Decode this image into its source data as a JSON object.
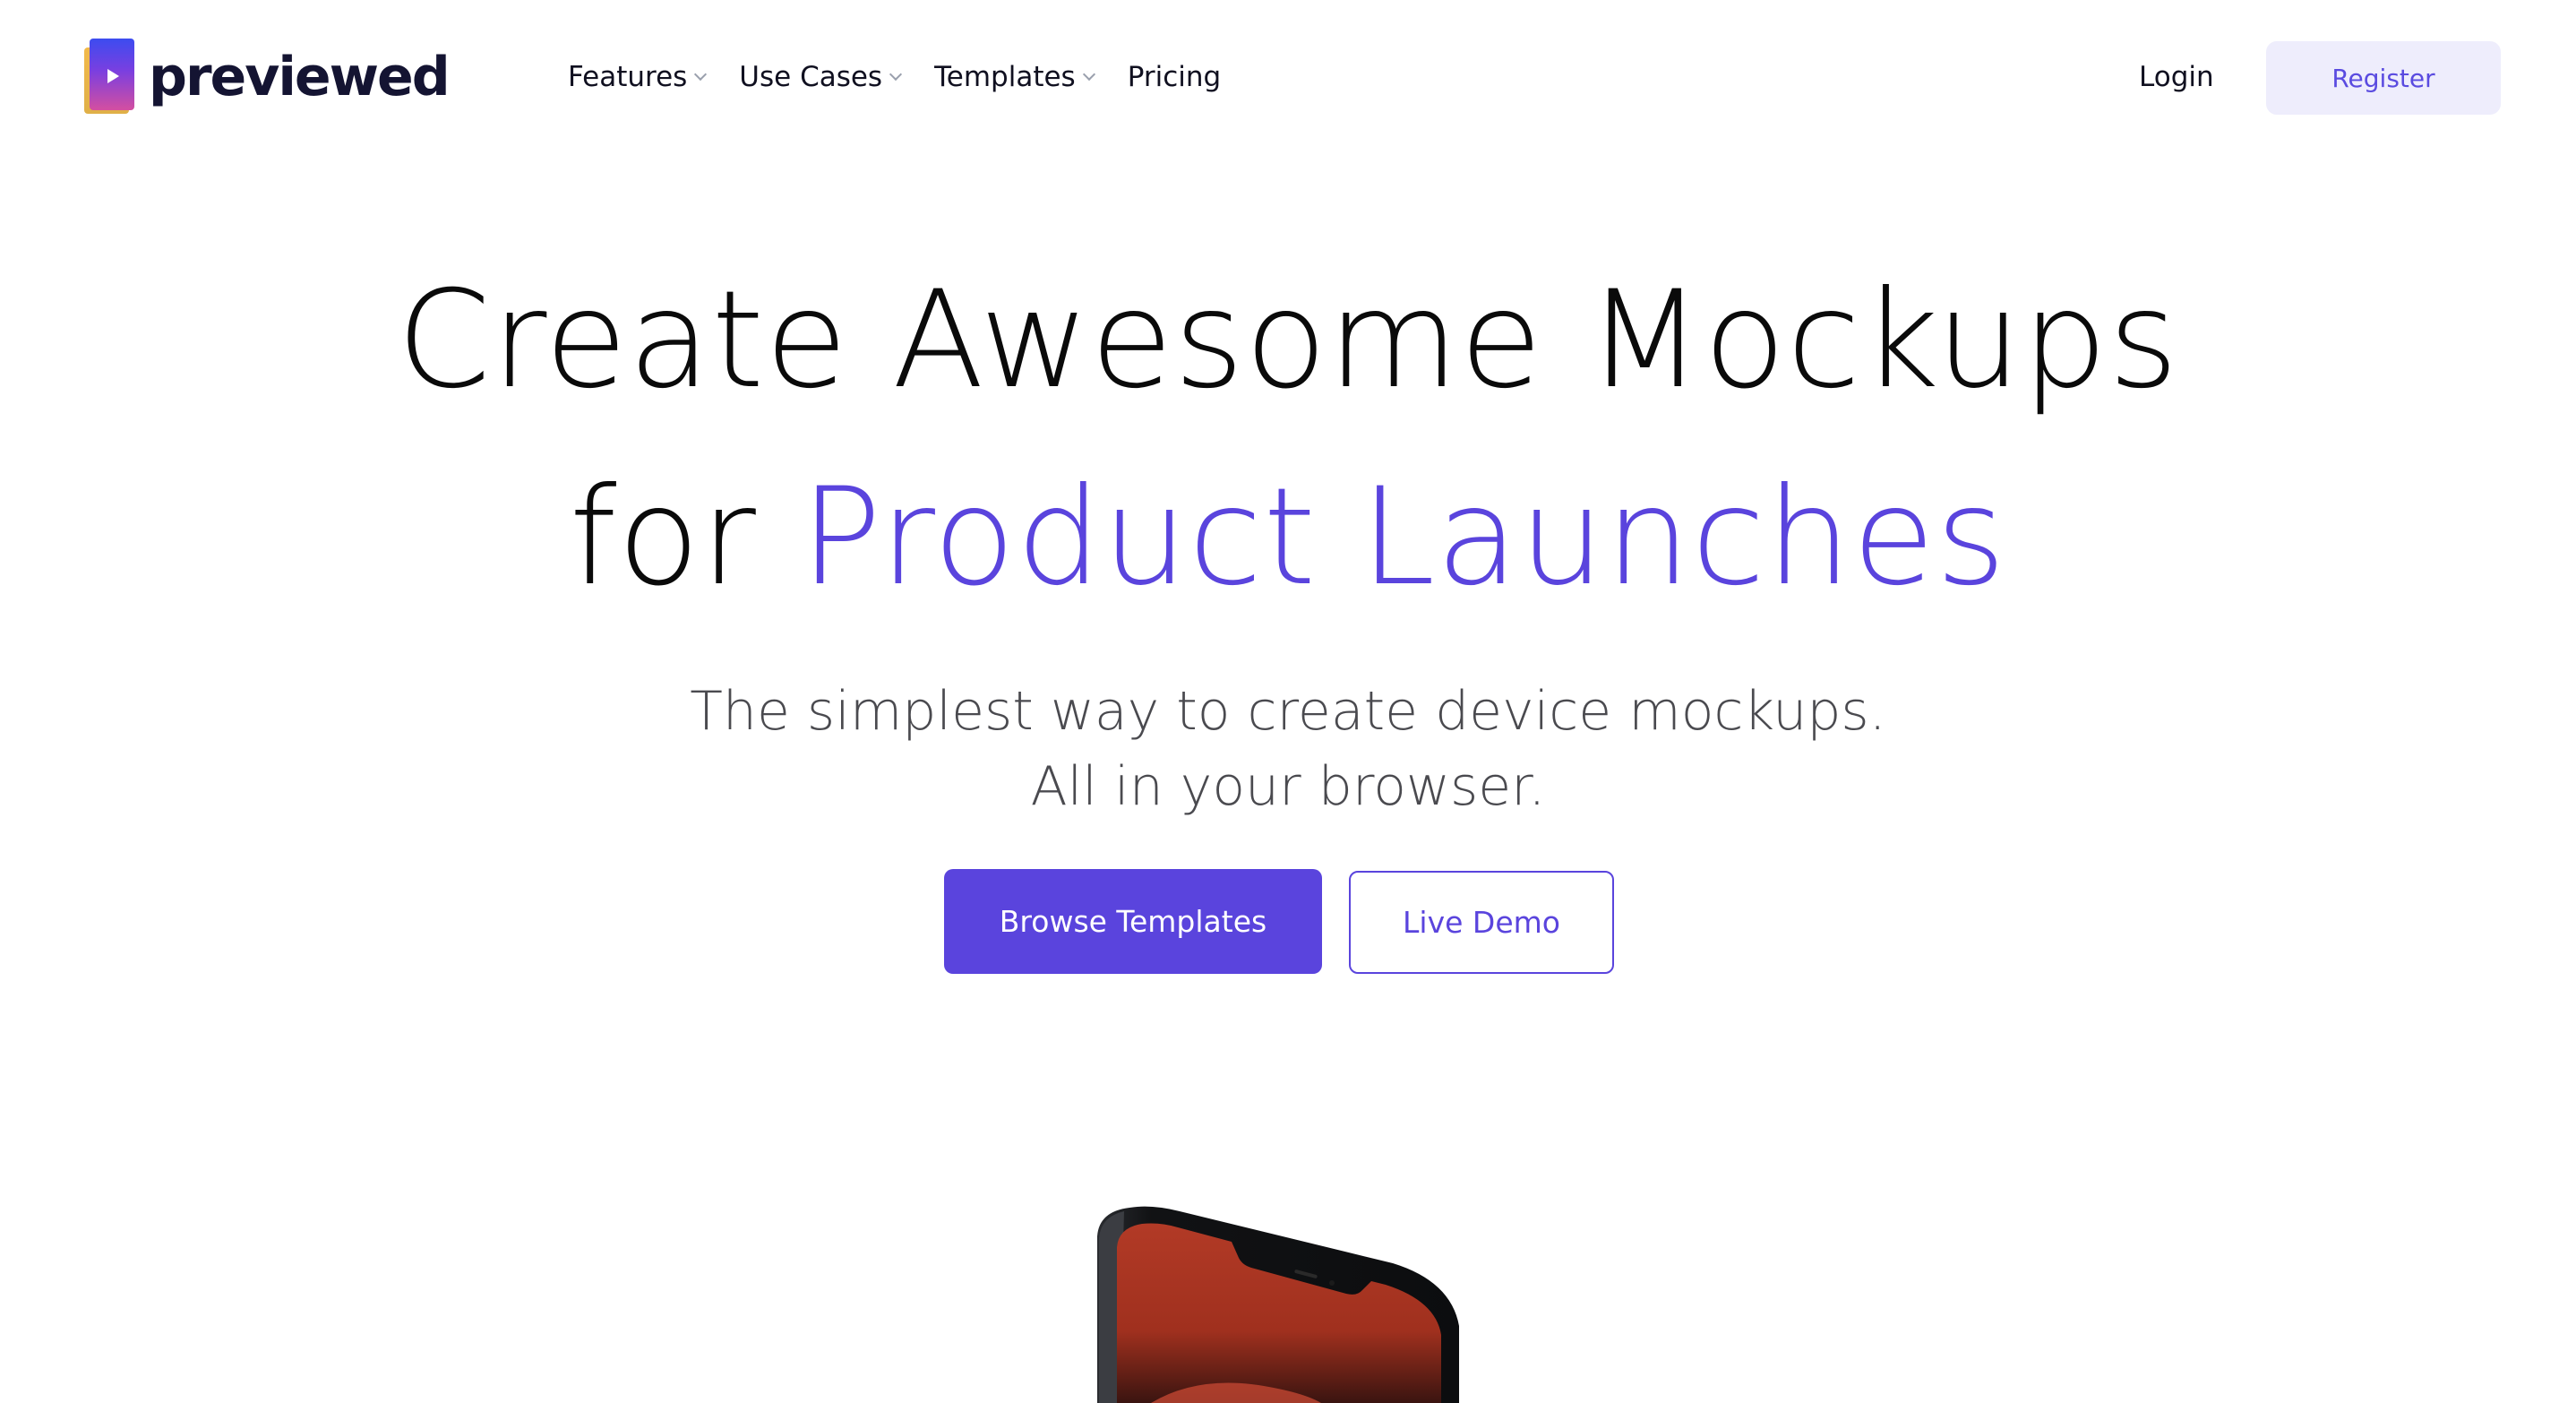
{
  "brand": {
    "name": "previewed",
    "icon": "play-icon",
    "colors": {
      "accent": "#5A44DD",
      "text": "#0A0A0A",
      "register_bg": "#EEEDFC"
    }
  },
  "nav": {
    "items": [
      {
        "label": "Features",
        "has_dropdown": true
      },
      {
        "label": "Use Cases",
        "has_dropdown": true
      },
      {
        "label": "Templates",
        "has_dropdown": true
      },
      {
        "label": "Pricing",
        "has_dropdown": false
      }
    ],
    "login_label": "Login",
    "register_label": "Register"
  },
  "hero": {
    "title_line1": "Create Awesome Mockups",
    "title_line2_prefix": "for",
    "title_line2_accent": "Product Launches",
    "subtitle_line1": "The simplest way to create device mockups.",
    "subtitle_line2": "All in your browser.",
    "primary_cta": "Browse Templates",
    "secondary_cta": "Live Demo"
  },
  "mockup": {
    "device": "smartphone",
    "screen_color": "#C0392B"
  }
}
